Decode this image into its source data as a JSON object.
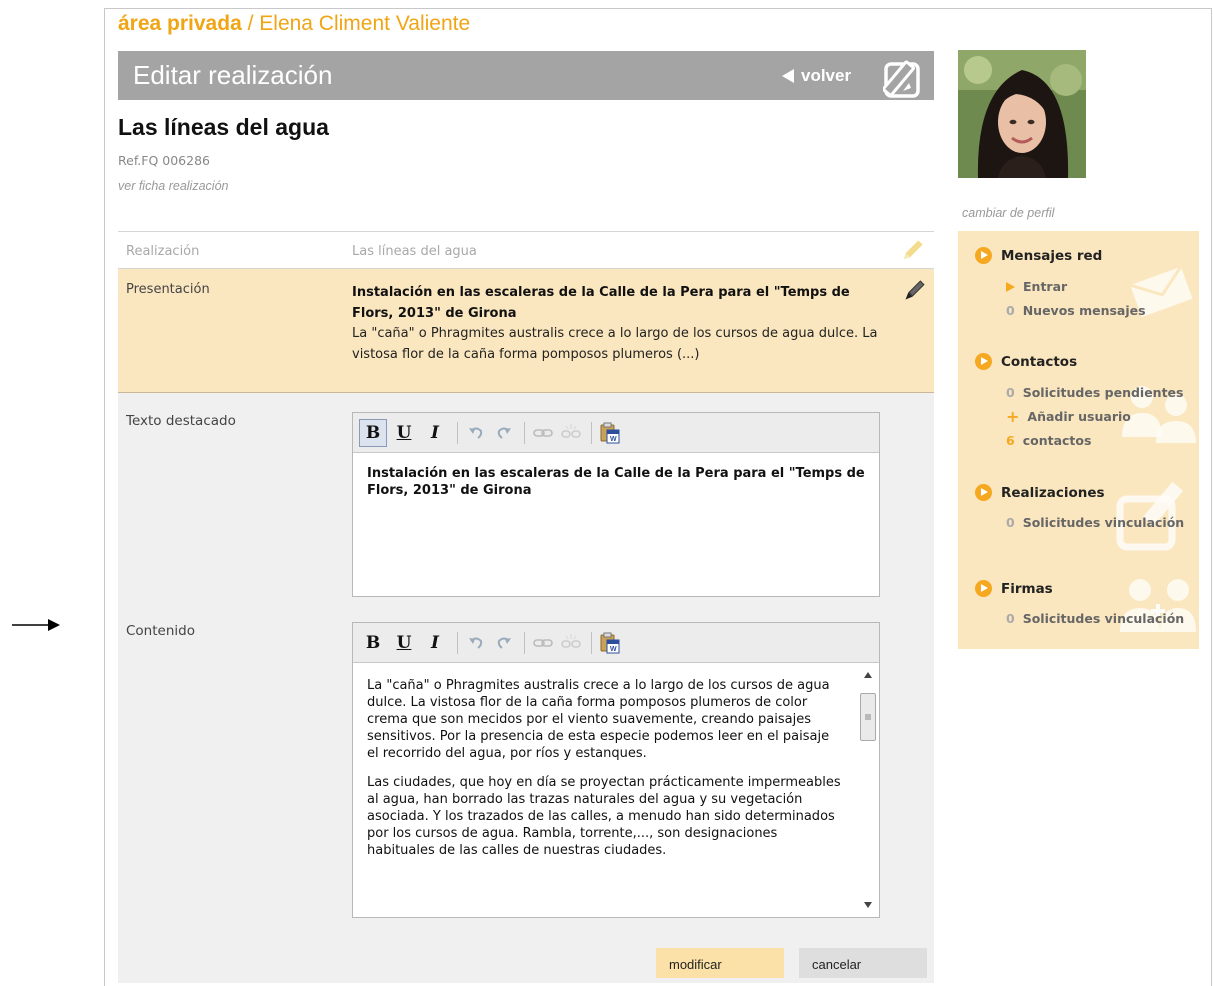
{
  "breadcrumb": {
    "section": "área privada",
    "separator": " / ",
    "user_name": "Elena Climent Valiente"
  },
  "header": {
    "title": "Editar realización",
    "back_label": "volver"
  },
  "work": {
    "title": "Las líneas del agua",
    "ref": "Ref.FQ 006286",
    "view_link": "ver ficha realización"
  },
  "form": {
    "realizacion": {
      "label": "Realización",
      "value": "Las líneas del agua"
    },
    "presentacion": {
      "label": "Presentación",
      "bold_text": "Instalación en las escaleras de la Calle de la Pera para el \"Temps de Flors, 2013\" de Girona",
      "text": "La \"caña\" o Phragmites australis crece a lo largo de los cursos de agua dulce. La vistosa flor de la caña forma pomposos plumeros (...)"
    },
    "texto_destacado": {
      "label": "Texto destacado",
      "content": "Instalación en las escaleras de la Calle de la Pera para el \"Temps de Flors, 2013\" de Girona"
    },
    "contenido": {
      "label": "Contenido",
      "paragraphs": [
        "La \"caña\" o Phragmites australis crece a lo largo de los cursos de agua dulce. La vistosa flor de la caña forma pomposos plumeros de color crema que son mecidos por el viento suavemente, creando paisajes sensitivos. Por la presencia de esta especie podemos leer en el paisaje el recorrido del agua, por ríos y estanques.",
        "Las ciudades, que hoy en día se proyectan prácticamente impermeables al agua, han borrado las trazas naturales del agua y su vegetación asociada. Y los trazados de las calles, a menudo han sido determinados por los cursos de agua. Rambla, torrente,..., son designaciones habituales de las calles de nuestras ciudades."
      ]
    },
    "toolbar": {
      "bold": "B",
      "underline": "U",
      "italic": "I"
    },
    "buttons": {
      "submit": "modificar",
      "cancel": "cancelar"
    }
  },
  "profile": {
    "change_label": "cambiar de perfil"
  },
  "sidebar": {
    "mensajes": {
      "title": "Mensajes red",
      "enter_label": "Entrar",
      "new_count": "0",
      "new_label": "Nuevos mensajes"
    },
    "contactos": {
      "title": "Contactos",
      "pending_count": "0",
      "pending_label": "Solicitudes pendientes",
      "add_symbol": "+",
      "add_label": "Añadir usuario",
      "contacts_count": "6",
      "contacts_label": "contactos"
    },
    "realizaciones": {
      "title": "Realizaciones",
      "count": "0",
      "label": "Solicitudes vinculación"
    },
    "firmas": {
      "title": "Firmas",
      "count": "0",
      "label": "Solicitudes vinculación"
    }
  },
  "colors": {
    "accent": "#f5a820",
    "highlight": "#fbe7bf",
    "header": "#a4a4a4"
  },
  "icons": {
    "annotation": "right-arrow-icon",
    "header": "edit-pencil-icon",
    "toolbar": [
      "undo-icon",
      "redo-icon",
      "link-icon",
      "unlink-icon",
      "paste-from-word-icon"
    ],
    "sidebar": [
      "envelope-icon",
      "people-icon",
      "edit-icon",
      "people-add-icon"
    ]
  }
}
